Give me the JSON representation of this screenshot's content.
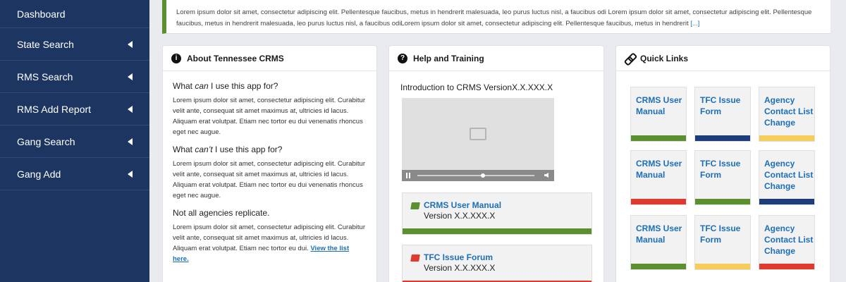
{
  "sidebar": {
    "items": [
      {
        "label": "Dashboard"
      },
      {
        "label": "State Search"
      },
      {
        "label": "RMS Search"
      },
      {
        "label": "RMS Add Report"
      },
      {
        "label": "Gang Search"
      },
      {
        "label": "Gang Add"
      }
    ]
  },
  "alert": {
    "text": "Lorem ipsum dolor sit amet, consectetur adipiscing elit. Pellentesque faucibus, metus in hendrerit malesuada, leo purus luctus nisl, a faucibus odi Lorem ipsum dolor sit amet, consectetur adipiscing elit. Pellentesque faucibus, metus in hendrerit malesuada, leo purus luctus nisl, a faucibus odiLorem ipsum dolor sit amet, consectetur adipiscing elit. Pellentesque faucibus, metus in hendrerit",
    "more": "[...]"
  },
  "about": {
    "title": "About Tennessee CRMS",
    "q1_pre": "What ",
    "q1_em": "can",
    "q1_post": " I use this app for?",
    "p1": "Lorem ipsum dolor sit amet, consectetur adipiscing elit. Curabitur velit ante, consequat sit amet maximus at, ultricies id lacus. Aliquam erat volutpat. Etiam nec tortor eu dui venenatis rhoncus eget nec augue.",
    "q2_pre": "What ",
    "q2_em": "can’t",
    "q2_post": " I use this app for?",
    "p2": "Lorem ipsum dolor sit amet, consectetur adipiscing elit. Curabitur velit ante, consequat sit amet maximus at, ultricies id lacus. Aliquam erat volutpat. Etiam nec tortor eu dui venenatis rhoncus eget nec augue.",
    "q3": "Not all agencies replicate.",
    "p3": "Lorem ipsum dolor sit amet, consectetur adipiscing elit. Curabitur velit ante, consequat sit amet maximus at, ultricies id lacus. Aliquam erat volutpat. Etiam nec tortor eu dui.",
    "p3_link": "View the list here."
  },
  "help": {
    "title": "Help and Training",
    "intro": "Introduction to CRMS VersionX.X.XXX.X",
    "docs": [
      {
        "title": "CRMS User Manual",
        "version": "Version X.X.XXX.X",
        "color": "#5b8f2f"
      },
      {
        "title": "TFC Issue Forum",
        "version": "Version X.X.XXX.X",
        "color": "#e03a2e"
      }
    ]
  },
  "quick_links": {
    "title": "Quick Links",
    "tiles": [
      {
        "label": "CRMS User Manual",
        "color": "#5b8f2f"
      },
      {
        "label": "TFC Issue Form",
        "color": "#1c3d7a"
      },
      {
        "label": "Agency Contact List Change",
        "color": "#f6cd5a"
      },
      {
        "label": "CRMS User Manual",
        "color": "#e03a2e"
      },
      {
        "label": "TFC Issue Form",
        "color": "#5b8f2f"
      },
      {
        "label": "Agency Contact List Change",
        "color": "#1c3d7a"
      },
      {
        "label": "CRMS User Manual",
        "color": "#5b8f2f"
      },
      {
        "label": "TFC Issue Form",
        "color": "#f6cd5a"
      },
      {
        "label": "Agency Contact List Change",
        "color": "#e03a2e"
      }
    ]
  }
}
